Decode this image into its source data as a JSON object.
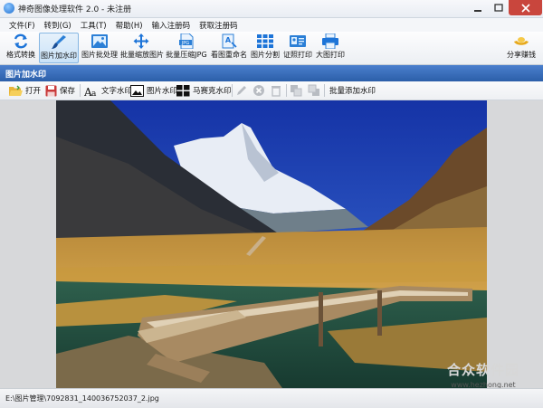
{
  "window": {
    "title": "神奇图像处理软件 2.0 - 未注册"
  },
  "menu": [
    "文件(F)",
    "转到(G)",
    "工具(T)",
    "帮助(H)",
    "输入注册码",
    "获取注册码"
  ],
  "toolbar": {
    "items": [
      {
        "label": "格式转换",
        "icon": "format-convert-icon"
      },
      {
        "label": "图片加水印",
        "icon": "brush-icon",
        "active": true
      },
      {
        "label": "图片批处理",
        "icon": "image-batch-icon"
      },
      {
        "label": "批量缩放图片",
        "icon": "resize-arrows-icon"
      },
      {
        "label": "批量压缩JPG",
        "icon": "jpg-file-icon"
      },
      {
        "label": "看图重命名",
        "icon": "rename-icon"
      },
      {
        "label": "图片分割",
        "icon": "grid-split-icon"
      },
      {
        "label": "证照打印",
        "icon": "id-card-icon"
      },
      {
        "label": "大图打印",
        "icon": "printer-icon"
      }
    ],
    "share_label": "分享赚钱",
    "share_icon": "gold-ingot-icon"
  },
  "section": {
    "title": "图片加水印"
  },
  "subtoolbar": {
    "open": "打开",
    "save": "保存",
    "text_watermark": "文字水印",
    "image_watermark": "图片水印",
    "mosaic_watermark": "马赛克水印",
    "batch_watermark": "批量添加水印"
  },
  "watermark": {
    "text": "合众软件园",
    "url": "www.hezhong.net"
  },
  "status": {
    "path": "E:\\图片管理\\7092831_140036752037_2.jpg"
  }
}
